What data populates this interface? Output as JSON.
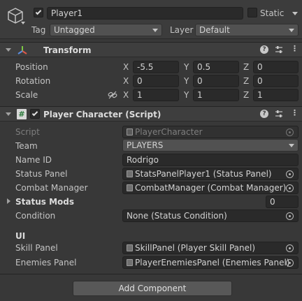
{
  "gameobject": {
    "icon": "cube-icon",
    "name": "Player1",
    "active": true,
    "static_label": "Static",
    "static": false,
    "tag_label": "Tag",
    "tag_value": "Untagged",
    "layer_label": "Layer",
    "layer_value": "Default"
  },
  "transform": {
    "title": "Transform",
    "icon": "transform-axes-icon",
    "position_label": "Position",
    "rotation_label": "Rotation",
    "scale_label": "Scale",
    "axis_x": "X",
    "axis_y": "Y",
    "axis_z": "Z",
    "position": {
      "x": "-5.5",
      "y": "0.5",
      "z": "0"
    },
    "rotation": {
      "x": "0",
      "y": "0",
      "z": "0"
    },
    "scale": {
      "x": "1",
      "y": "1",
      "z": "1"
    }
  },
  "script_component": {
    "title": "Player Character (Script)",
    "icon": "csharp-script-icon",
    "enabled": true,
    "script_label": "Script",
    "script_value": "PlayerCharacter",
    "team_label": "Team",
    "team_value": "PLAYERS",
    "name_id_label": "Name ID",
    "name_id_value": "Rodrigo",
    "status_panel_label": "Status Panel",
    "status_panel_value": "StatsPanelPlayer1 (Status Panel)",
    "combat_manager_label": "Combat Manager",
    "combat_manager_value": "CombatManager (Combat Manager)",
    "status_mods_label": "Status Mods",
    "status_mods_count": "0",
    "condition_label": "Condition",
    "condition_value": "None (Status Condition)",
    "ui_header": "UI",
    "skill_panel_label": "Skill Panel",
    "skill_panel_value": "SkillPanel (Player Skill Panel)",
    "enemies_panel_label": "Enemies Panel",
    "enemies_panel_value": "PlayerEnemiesPanel (Enemies Panel)"
  },
  "add_component_label": "Add Component",
  "colors": {
    "background": "#383838",
    "header": "#3e3e3e",
    "field": "#2a2a2a",
    "button": "#585858"
  }
}
